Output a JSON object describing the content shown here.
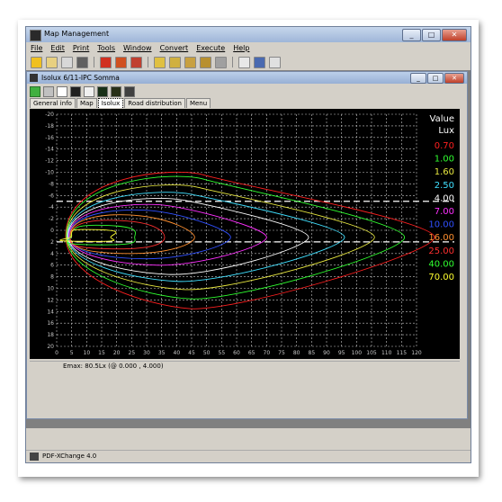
{
  "app": {
    "title": "Map Management",
    "window_buttons": [
      "_",
      "□",
      "✕"
    ]
  },
  "menu": [
    "File",
    "Edit",
    "Print",
    "Tools",
    "Window",
    "Convert",
    "Execute",
    "Help"
  ],
  "toolbar": {
    "icons": [
      "exit-icon",
      "open-icon",
      "close-icon",
      "template-icon",
      "map-icon",
      "export-icon",
      "convert-icon",
      "report-icon",
      "save-report-icon",
      "save-all-icon",
      "print-icon",
      "window-icon",
      "screen-icon",
      "help-icon"
    ]
  },
  "child": {
    "title": "Isolux 6/11-IPC Somma",
    "window_buttons": [
      "_",
      "□",
      "✕"
    ],
    "toolbar_icons": [
      "r-icon",
      "save-icon",
      "grid-icon",
      "monitor-icon",
      "table-icon",
      "chart-icon",
      "chart2-icon",
      "export-icon"
    ],
    "tabs": [
      "General info",
      "Map",
      "Isolux",
      "Road distribution",
      "Menu"
    ],
    "active_tab": 2
  },
  "chart_data": {
    "type": "contour",
    "x_ticks": [
      "0",
      "5",
      "10",
      "15",
      "20",
      "25",
      "30",
      "35",
      "40",
      "45",
      "50",
      "55",
      "60",
      "65",
      "70",
      "75",
      "80",
      "85",
      "90",
      "95",
      "100",
      "105",
      "110",
      "115",
      "120"
    ],
    "y_ticks": [
      "-20",
      "-18",
      "-16",
      "-14",
      "-12",
      "-10",
      "-8",
      "-6",
      "-4",
      "-2",
      "0",
      "2",
      "4",
      "6",
      "8",
      "10",
      "12",
      "14",
      "16",
      "18",
      "20"
    ],
    "xlim": [
      0,
      120
    ],
    "ylim": [
      -20,
      20
    ],
    "grid": true,
    "legend_title": "Value",
    "legend_unit": "Lux",
    "legend_placement": "right",
    "levels": [
      {
        "value": "0.70",
        "color": "#ff2020"
      },
      {
        "value": "1.00",
        "color": "#30ff30"
      },
      {
        "value": "1.60",
        "color": "#e8e840"
      },
      {
        "value": "2.50",
        "color": "#40e0ff"
      },
      {
        "value": "4.00",
        "color": "#ffffff"
      },
      {
        "value": "7.00",
        "color": "#ff30ff"
      },
      {
        "value": "10.00",
        "color": "#3050ff"
      },
      {
        "value": "16.00",
        "color": "#ff9030"
      },
      {
        "value": "25.00",
        "color": "#ff3030"
      },
      {
        "value": "40.00",
        "color": "#30ff30"
      },
      {
        "value": "70.00",
        "color": "#ffff30"
      }
    ],
    "road_edges_y": [
      -5,
      2
    ]
  },
  "status": {
    "text": "Emax: 80.5Lx (@ 0.000 , 4.000)"
  },
  "taskbar": {
    "label": "PDF-XChange 4.0"
  }
}
